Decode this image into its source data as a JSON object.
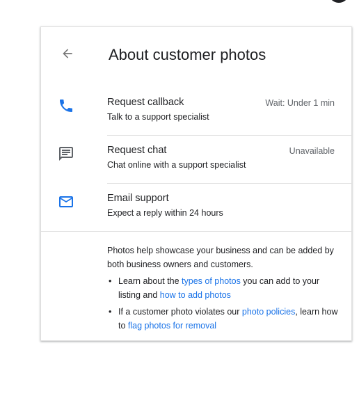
{
  "colors": {
    "accent": "#1a73e8",
    "text": "#202124",
    "secondary_text": "#5f6368",
    "divider": "#e0e0e0"
  },
  "header": {
    "back_icon": "arrow-back-icon",
    "title": "About customer photos"
  },
  "options": [
    {
      "icon": "phone-icon",
      "title": "Request callback",
      "subtitle": "Talk to a support specialist",
      "status": "Wait: Under 1 min"
    },
    {
      "icon": "chat-icon",
      "title": "Request chat",
      "subtitle": "Chat online with a support specialist",
      "status": "Unavailable"
    },
    {
      "icon": "email-icon",
      "title": "Email support",
      "subtitle": "Expect a reply within 24 hours",
      "status": ""
    }
  ],
  "info": {
    "intro": "Photos help showcase your business and can be added by both business owners and customers.",
    "bullet_char": "•",
    "bullet1": {
      "prefix": "Learn about the ",
      "link1": "types of photos",
      "middle": " you can add to your listing and ",
      "link2": "how to add photos"
    },
    "bullet2": {
      "prefix": "If a customer photo violates our ",
      "link1": "photo policies",
      "middle": ", learn how to ",
      "link2": "flag photos for removal"
    }
  }
}
